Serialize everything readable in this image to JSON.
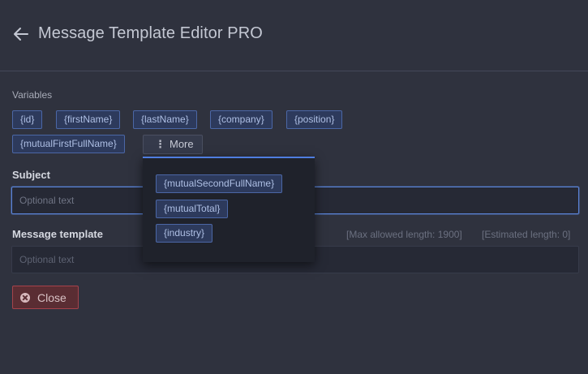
{
  "header": {
    "title": "Message Template Editor PRO"
  },
  "variables": {
    "label": "Variables",
    "chips": [
      "{id}",
      "{firstName}",
      "{lastName}",
      "{company}",
      "{position}",
      "{mutualFirstFullName}"
    ],
    "more_label": "More",
    "more_items": [
      "{mutualSecondFullName}",
      "{mutualTotal}",
      "{industry}"
    ]
  },
  "subject": {
    "label": "Subject",
    "placeholder": "Optional text",
    "value": ""
  },
  "message": {
    "label": "Message template",
    "placeholder": "Optional text",
    "value": "",
    "max_length": "[Max allowed length: 1900]",
    "estimated_length": "[Estimated length: 0]"
  },
  "actions": {
    "close_label": "Close"
  },
  "colors": {
    "accent": "#4f7ee0",
    "chip_bg": "#2d3a5c",
    "danger_border": "#a5434b",
    "background": "#2f323e"
  }
}
